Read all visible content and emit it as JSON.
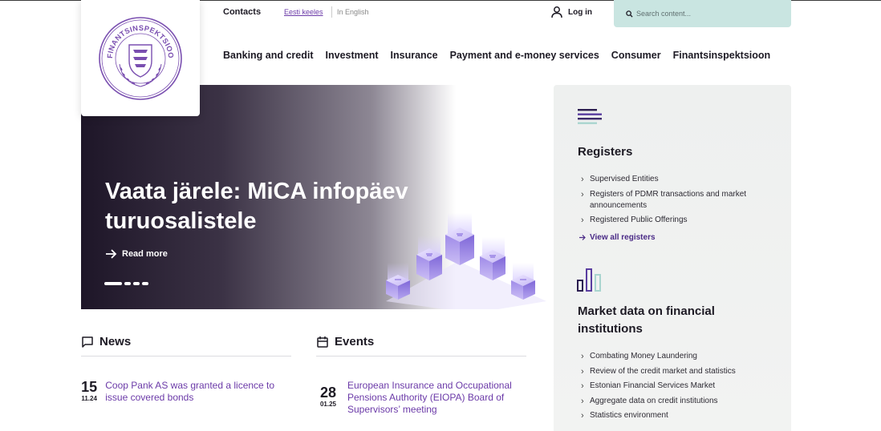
{
  "header": {
    "contacts": "Contacts",
    "lang_et": "Eesti keeles",
    "lang_en": "In English",
    "login": "Log in",
    "search_placeholder": "Search content..."
  },
  "nav": [
    "Banking and credit",
    "Investment",
    "Insurance",
    "Payment and e-money services",
    "Consumer",
    "Finantsinspektsioon"
  ],
  "logo": {
    "seal_text": "FINANTSINSPEKTSIOON"
  },
  "hero": {
    "title": "Vaata järele: MiCA infopäev turuosalistele",
    "read_more": "Read more",
    "slides": 4,
    "active_slide": 1
  },
  "news": {
    "heading": "News",
    "items": [
      {
        "day": "15",
        "month": "11.24",
        "title": "Coop Pank AS was granted a licence to issue covered bonds"
      }
    ]
  },
  "events": {
    "heading": "Events",
    "items": [
      {
        "day": "28",
        "month": "01.25",
        "title": "European Insurance and Occupational Pensions Authority (EIOPA) Board of Supervisors’ meeting"
      }
    ]
  },
  "registers": {
    "heading": "Registers",
    "items": [
      "Supervised Entities",
      "Registers of PDMR transactions and market announcements",
      "Registered Public Offerings"
    ],
    "view_all": "View all registers"
  },
  "market_data": {
    "heading": "Market data on financial institutions",
    "items": [
      "Combating Money Laundering",
      "Review of the credit market and statistics",
      "Estonian Financial Services Market",
      "Aggregate data on credit institutions",
      "Statistics environment"
    ]
  },
  "colors": {
    "accent": "#6b3aa8",
    "search_bg": "#c9e5e1",
    "hero_dark": "#1e1628",
    "panel_bg": "#eef0ef"
  }
}
